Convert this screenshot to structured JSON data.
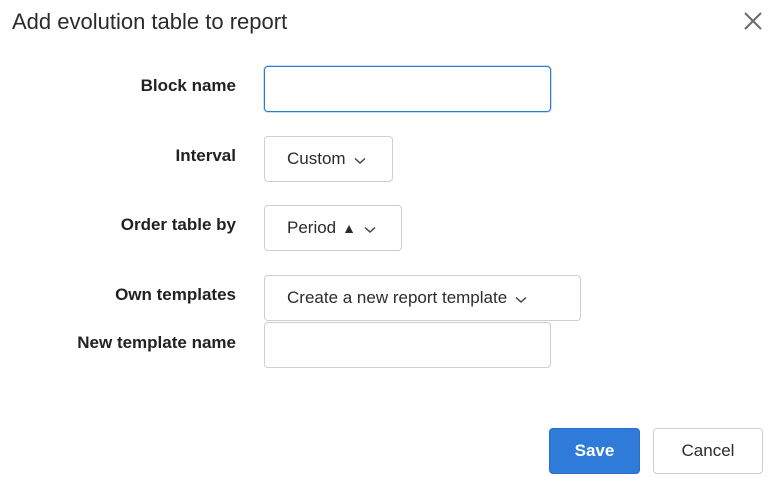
{
  "dialog": {
    "title": "Add evolution table to report",
    "close_icon": "close-icon"
  },
  "form": {
    "block_name": {
      "label": "Block name",
      "value": "",
      "placeholder": ""
    },
    "interval": {
      "label": "Interval",
      "value": "Custom",
      "icon": "chevron-down-icon"
    },
    "order_table_by": {
      "label": "Order table by",
      "value": "Period",
      "sort_glyph": "▲",
      "icon": "chevron-down-icon"
    },
    "own_templates": {
      "label": "Own templates",
      "value": "Create a new report template",
      "icon": "chevron-down-icon"
    },
    "new_template_name": {
      "label": "New template name",
      "value": "",
      "placeholder": ""
    }
  },
  "actions": {
    "save_label": "Save",
    "cancel_label": "Cancel"
  },
  "colors": {
    "primary": "#2f7bd9",
    "focus_border": "#2d7ad6",
    "input_border": "#cfcfcf"
  }
}
